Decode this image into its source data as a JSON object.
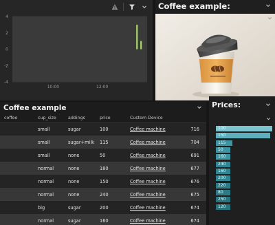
{
  "chart_tile": {
    "icons": [
      "warning-icon",
      "filter-icon",
      "chevron-down-icon"
    ]
  },
  "chart_data": {
    "type": "bar",
    "title": "",
    "xlabel": "",
    "ylabel": "",
    "xticks": [
      "10:00",
      "12:00"
    ],
    "yticks": [
      "4",
      "2",
      "0",
      "-2",
      "-4"
    ],
    "ylim": [
      -4,
      4
    ],
    "grid": true,
    "series": [
      {
        "color": "#a6d96a",
        "points": [
          {
            "x": "13:25",
            "value": 3
          },
          {
            "x": "13:35",
            "value": 1
          }
        ]
      }
    ]
  },
  "image_tile": {
    "title": "Coffee example:"
  },
  "table_tile": {
    "title": "Coffee example",
    "columns": [
      "coffee",
      "cup_size",
      "addings",
      "price",
      "Custom Device",
      ""
    ],
    "rows": [
      [
        "",
        "small",
        "sugar",
        "100",
        "Coffee machine",
        "716"
      ],
      [
        "",
        "small",
        "sugar+milk",
        "115",
        "Coffee machine",
        "704"
      ],
      [
        "",
        "small",
        "none",
        "50",
        "Coffee machine",
        "691"
      ],
      [
        "",
        "normal",
        "none",
        "180",
        "Coffee machine",
        "677"
      ],
      [
        "",
        "normal",
        "none",
        "150",
        "Coffee machine",
        "676"
      ],
      [
        "",
        "normal",
        "none",
        "240",
        "Coffee machine",
        "675"
      ],
      [
        "",
        "big",
        "sugar",
        "200",
        "Coffee machine",
        "674"
      ],
      [
        "",
        "normal",
        "sugar",
        "160",
        "Coffee machine",
        "674"
      ]
    ]
  },
  "prices_tile": {
    "title": "Prices:",
    "bars": [
      {
        "label": "100",
        "value": 1.0,
        "color": "#7cc3cf"
      },
      {
        "label": "150",
        "value": 0.96,
        "color": "#5fb0bc"
      },
      {
        "label": "115",
        "value": 0.29,
        "color": "#3b95a2"
      },
      {
        "label": "50",
        "value": 0.25,
        "color": "#3b95a2"
      },
      {
        "label": "160",
        "value": 0.25,
        "color": "#3b95a2"
      },
      {
        "label": "240",
        "value": 0.25,
        "color": "#2f8591"
      },
      {
        "label": "160",
        "value": 0.25,
        "color": "#2f8591"
      },
      {
        "label": "200",
        "value": 0.25,
        "color": "#2f8591"
      },
      {
        "label": "220",
        "value": 0.25,
        "color": "#2c7b86"
      },
      {
        "label": "80",
        "value": 0.25,
        "color": "#2c7b86"
      },
      {
        "label": "250",
        "value": 0.25,
        "color": "#27737e"
      },
      {
        "label": "120",
        "value": 0.25,
        "color": "#27737e"
      }
    ]
  }
}
